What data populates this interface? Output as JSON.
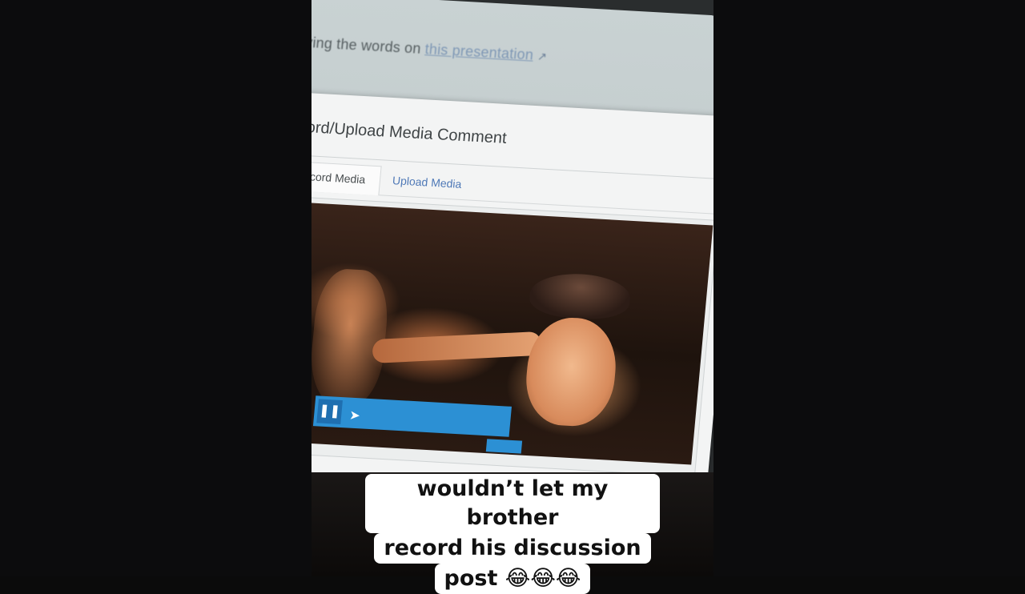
{
  "page_text": {
    "top_prefix": "ying the words on",
    "top_link": "this presentation",
    "top_link_icon": "external-link-icon"
  },
  "dialog": {
    "title": "ecord/Upload Media Comment",
    "tabs": [
      {
        "label": "Record Media",
        "active": true
      },
      {
        "label": "Upload Media",
        "active": false
      }
    ]
  },
  "player": {
    "pause_icon": "pause-icon",
    "cursor_icon": "cursor-icon"
  },
  "caption": {
    "lines": [
      "wouldn’t let my brother",
      "record his discussion",
      "post 😂😂😂"
    ]
  },
  "colors": {
    "accent_blue": "#2c90d4",
    "link_blue": "#4f79b7"
  }
}
